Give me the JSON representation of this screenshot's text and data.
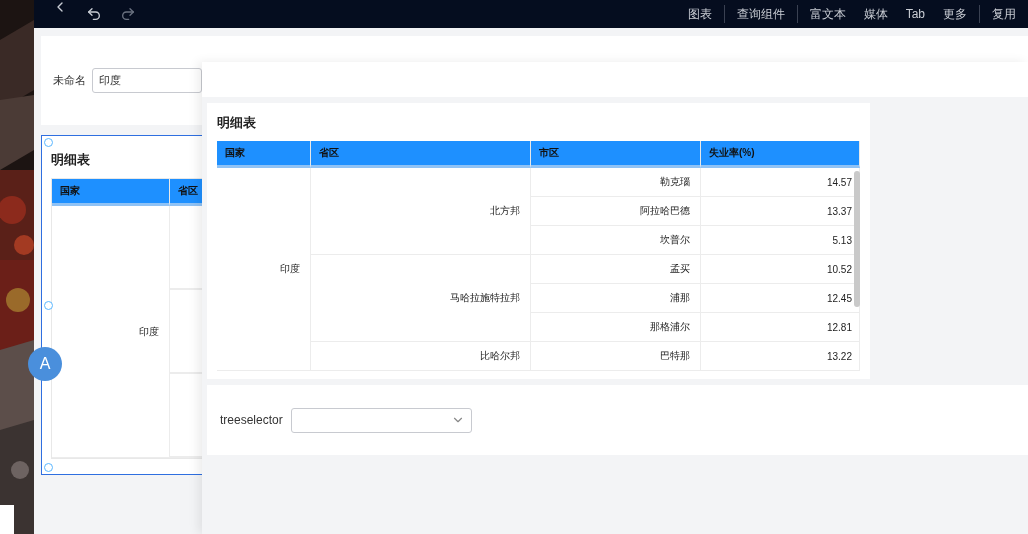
{
  "toolbar": {
    "menu_groups": [
      [
        "图表"
      ],
      [
        "查询组件"
      ],
      [
        "富文本",
        "媒体",
        "Tab",
        "更多"
      ],
      [
        "复用"
      ]
    ]
  },
  "filter": {
    "label": "未命名",
    "value": "印度"
  },
  "back_table": {
    "title": "明细表",
    "selected": true,
    "columns": [
      "国家",
      "省区"
    ],
    "country": "印度"
  },
  "floating_badge": "A",
  "detail_table": {
    "title": "明细表",
    "columns": [
      "国家",
      "省区",
      "市区",
      "失业率(%)"
    ],
    "groups": [
      {
        "country": "印度",
        "provinces": [
          {
            "name": "北方邦",
            "cities": [
              {
                "name": "勒克瑙",
                "rate": "14.57"
              },
              {
                "name": "阿拉哈巴德",
                "rate": "13.37"
              },
              {
                "name": "坎普尔",
                "rate": "5.13"
              }
            ]
          },
          {
            "name": "马哈拉施特拉邦",
            "cities": [
              {
                "name": "孟买",
                "rate": "10.52"
              },
              {
                "name": "浦那",
                "rate": "12.45"
              },
              {
                "name": "那格浦尔",
                "rate": "12.81"
              }
            ]
          },
          {
            "name": "比哈尔邦",
            "cities": [
              {
                "name": "巴特那",
                "rate": "13.22"
              }
            ]
          }
        ]
      }
    ]
  },
  "treeselector": {
    "label": "treeselector"
  }
}
